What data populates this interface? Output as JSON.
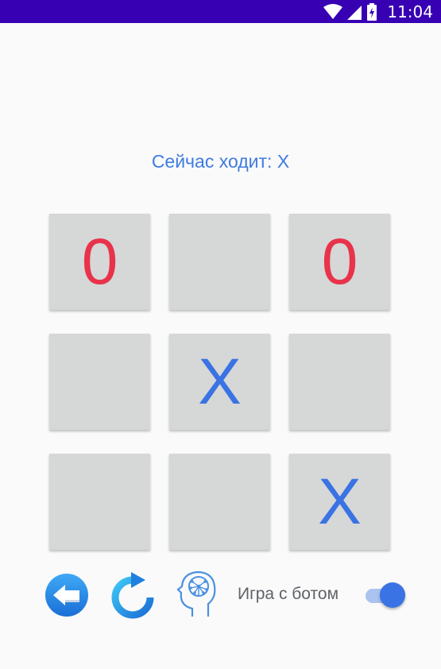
{
  "status_bar": {
    "time": "11:04",
    "icons": [
      "wifi-icon",
      "signal-icon",
      "battery-icon"
    ],
    "background": "#3700b3"
  },
  "game": {
    "turn_text": "Сейчас ходит: X",
    "board": [
      [
        "0",
        "",
        "0"
      ],
      [
        "",
        "X",
        ""
      ],
      [
        "",
        "",
        "X"
      ]
    ],
    "colors": {
      "o": "#e8334a",
      "x": "#3a73e3",
      "cell": "#d6d7d7"
    }
  },
  "controls": {
    "back_icon": "back-arrow-icon",
    "restart_icon": "restart-icon",
    "bot_icon": "brain-head-icon",
    "bot_label": "Игра с ботом",
    "bot_toggle_on": true
  }
}
